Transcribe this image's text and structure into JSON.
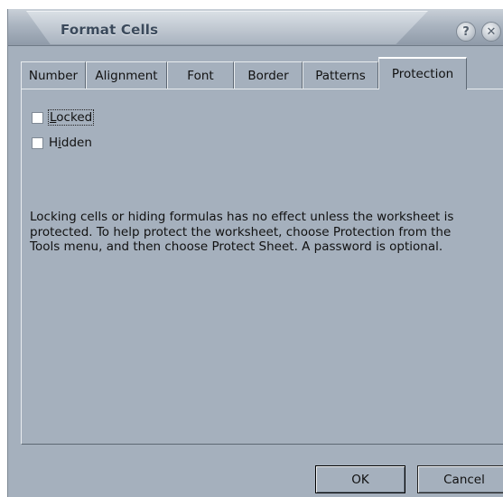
{
  "window": {
    "title": "Format Cells",
    "help_glyph": "?",
    "close_glyph": "✕"
  },
  "tabs": [
    {
      "label": "Number",
      "active": false
    },
    {
      "label": "Alignment",
      "active": false
    },
    {
      "label": "Font",
      "active": false
    },
    {
      "label": "Border",
      "active": false
    },
    {
      "label": "Patterns",
      "active": false
    },
    {
      "label": "Protection",
      "active": true
    }
  ],
  "protection": {
    "locked": {
      "label_prefix": "",
      "label_mnemonic": "L",
      "label_rest": "ocked",
      "checked": false
    },
    "hidden": {
      "label_prefix": "H",
      "label_mnemonic": "i",
      "label_rest": "dden",
      "checked": false
    },
    "info_text": "Locking cells or hiding formulas has no effect unless the worksheet is protected. To help protect the worksheet, choose Protection from the Tools menu, and then choose Protect Sheet. A password is optional."
  },
  "buttons": {
    "ok_label": "OK",
    "cancel_label": "Cancel"
  }
}
